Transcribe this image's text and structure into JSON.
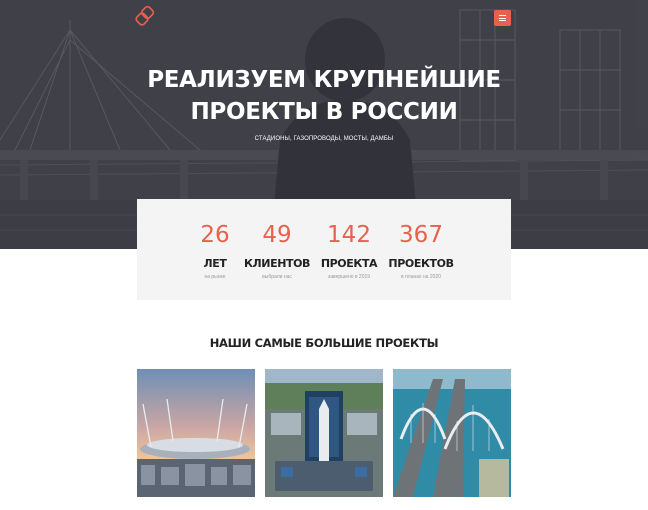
{
  "header": {
    "logo_icon": "interlocking-squares-logo",
    "menu_icon": "hamburger-icon",
    "accent_color": "#e8614c"
  },
  "hero": {
    "title_line1": "РЕАЛИЗУЕМ КРУПНЕЙШИЕ",
    "title_line2": "ПРОЕКТЫ В РОССИИ",
    "subtitle": "СТАДИОНЫ, ГАЗОПРОВОДЫ, МОСТЫ, ДАМБЫ"
  },
  "stats": [
    {
      "number": "26",
      "label": "ЛЕТ",
      "sub": "на рынке"
    },
    {
      "number": "49",
      "label": "КЛИЕНТОВ",
      "sub": "выбрали нас"
    },
    {
      "number": "142",
      "label": "ПРОЕКТА",
      "sub": "завершено в 2019"
    },
    {
      "number": "367",
      "label": "ПРОЕКТОВ",
      "sub": "в планах на 2020"
    }
  ],
  "projects": {
    "title": "НАШИ САМЫЕ БОЛЬШИЕ ПРОЕКТЫ",
    "items": [
      {
        "image": "stadium-photo"
      },
      {
        "image": "cosmodrome-rocket-photo"
      },
      {
        "image": "arch-bridge-photo"
      }
    ]
  }
}
